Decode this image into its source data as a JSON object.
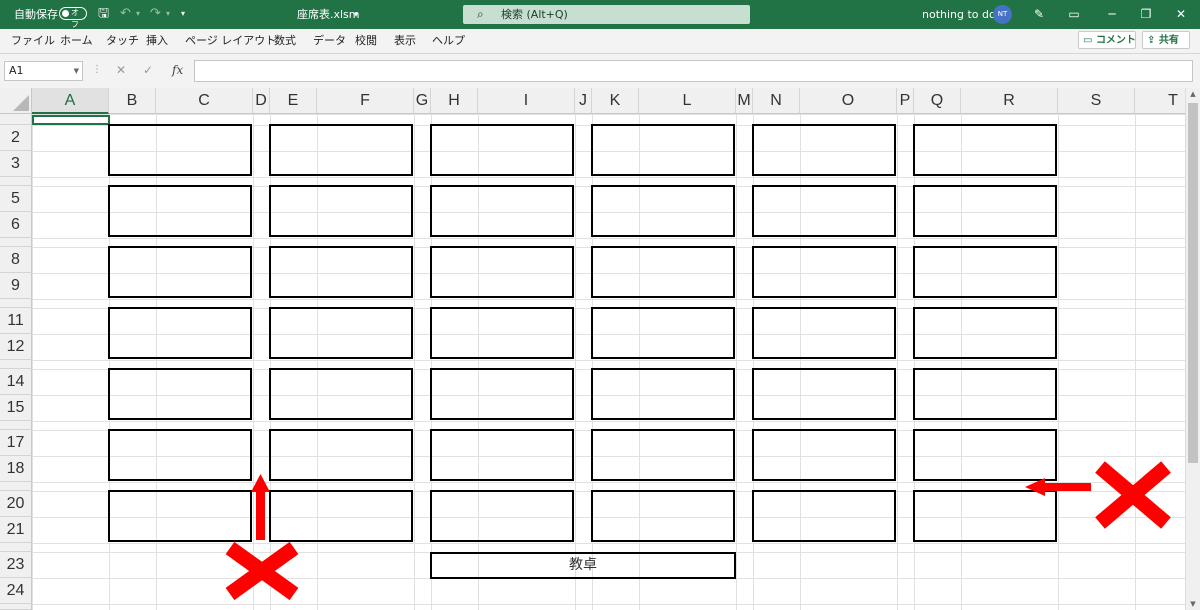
{
  "titlebar": {
    "autosave_label": "自動保存",
    "autosave_state": "オフ",
    "filename": "座席表.xlsm",
    "filename_caret": "▾",
    "search_placeholder": "検索 (Alt+Q)",
    "username": "nothing to do",
    "avatar_initials": "NT"
  },
  "ribbon": {
    "tabs": [
      "ファイル",
      "ホーム",
      "タッチ",
      "挿入",
      "ページ レイアウト",
      "数式",
      "データ",
      "校閲",
      "表示",
      "ヘルプ"
    ],
    "comment_label": "コメント",
    "share_label": "共有"
  },
  "formula_bar": {
    "name_box": "A1",
    "fx_label": "fx",
    "content": ""
  },
  "sheet": {
    "columns": [
      "A",
      "B",
      "C",
      "D",
      "E",
      "F",
      "G",
      "H",
      "I",
      "J",
      "K",
      "L",
      "M",
      "N",
      "O",
      "P",
      "Q",
      "R",
      "S",
      "T"
    ],
    "rows": [
      "",
      "2",
      "3",
      "",
      "5",
      "6",
      "",
      "8",
      "9",
      "",
      "11",
      "12",
      "",
      "14",
      "15",
      "",
      "17",
      "18",
      "",
      "20",
      "21",
      "",
      "23",
      "24"
    ],
    "active_cell": "A1",
    "seat_groups": 6,
    "seat_rows": 7,
    "teacher_desk_label": "教卓"
  },
  "annotations": {
    "color": "#ff0000",
    "marks": [
      "cross-left-bottom",
      "cross-right",
      "arrow-up",
      "arrow-left"
    ]
  },
  "colors": {
    "titlebar": "#217346",
    "selection": "#217346"
  }
}
